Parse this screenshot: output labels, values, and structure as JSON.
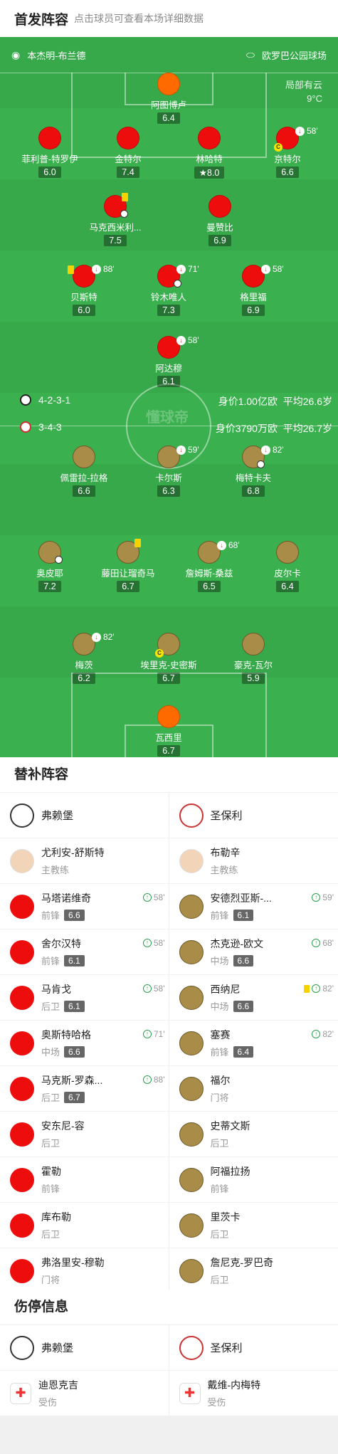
{
  "header": {
    "title": "首发阵容",
    "subtitle": "点击球员可查看本场详细数据"
  },
  "match": {
    "coach_home": "本杰明-布兰德",
    "stadium": "欧罗巴公园球场",
    "weather": "局部有云",
    "temp": "9°C"
  },
  "home_form": {
    "formation": "4-2-3-1",
    "value": "身价1.00亿欧",
    "age": "平均26.6岁"
  },
  "away_form": {
    "formation": "3-4-3",
    "value": "身价3790万欧",
    "age": "平均26.7岁"
  },
  "watermark": "懂球帝",
  "home_players": [
    {
      "name": "阿图博卢",
      "rating": "6.4"
    },
    {
      "name": "菲利普-特罗伊",
      "rating": "6.0"
    },
    {
      "name": "金特尔",
      "rating": "7.4"
    },
    {
      "name": "林哈特",
      "rating": "8.0"
    },
    {
      "name": "京特尔",
      "rating": "6.6",
      "sub": "58'"
    },
    {
      "name": "马克西米利...",
      "rating": "7.5"
    },
    {
      "name": "曼赞比",
      "rating": "6.9"
    },
    {
      "name": "贝斯特",
      "rating": "6.0",
      "sub": "88'"
    },
    {
      "name": "铃木唯人",
      "rating": "7.3",
      "sub": "71'"
    },
    {
      "name": "格里福",
      "rating": "6.9",
      "sub": "58'"
    },
    {
      "name": "阿达穆",
      "rating": "6.1",
      "sub": "58'"
    }
  ],
  "away_players": [
    {
      "name": "佩雷拉-拉格",
      "rating": "6.6"
    },
    {
      "name": "卡尔斯",
      "rating": "6.3",
      "sub": "59'"
    },
    {
      "name": "梅特卡夫",
      "rating": "6.8",
      "sub": "82'"
    },
    {
      "name": "奥皮耶",
      "rating": "7.2"
    },
    {
      "name": "藤田让瑠奇马",
      "rating": "6.7"
    },
    {
      "name": "詹姆斯-桑兹",
      "rating": "6.5",
      "sub": "68'"
    },
    {
      "name": "皮尔卡",
      "rating": "6.4"
    },
    {
      "name": "梅茨",
      "rating": "6.2",
      "sub": "82'"
    },
    {
      "name": "埃里克-史密斯",
      "rating": "6.7"
    },
    {
      "name": "豪克-瓦尔",
      "rating": "5.9"
    },
    {
      "name": "瓦西里",
      "rating": "6.7"
    }
  ],
  "subs": {
    "title": "替补阵容",
    "home_team": "弗赖堡",
    "away_team": "圣保利",
    "home_coach": {
      "name": "尤利安-舒斯特",
      "role": "主教练"
    },
    "away_coach": {
      "name": "布勒辛",
      "role": "主教练"
    },
    "home": [
      {
        "name": "马塔诺维奇",
        "pos": "前锋",
        "rating": "6.6",
        "ev": "58'"
      },
      {
        "name": "舍尔汉特",
        "pos": "前锋",
        "rating": "6.1",
        "ev": "58'"
      },
      {
        "name": "马肯戈",
        "pos": "后卫",
        "rating": "6.1",
        "ev": "58'"
      },
      {
        "name": "奥斯特哈格",
        "pos": "中场",
        "rating": "6.6",
        "ev": "71'"
      },
      {
        "name": "马克斯-罗森...",
        "pos": "后卫",
        "rating": "6.7",
        "ev": "88'"
      },
      {
        "name": "安东尼-容",
        "pos": "后卫"
      },
      {
        "name": "霍勒",
        "pos": "前锋"
      },
      {
        "name": "库布勒",
        "pos": "后卫"
      },
      {
        "name": "弗洛里安-穆勒",
        "pos": "门将"
      }
    ],
    "away": [
      {
        "name": "安德烈亚斯-...",
        "pos": "前锋",
        "rating": "6.1",
        "ev": "59'"
      },
      {
        "name": "杰克逊-欧文",
        "pos": "中场",
        "rating": "6.6",
        "ev": "68'"
      },
      {
        "name": "西纳尼",
        "pos": "中场",
        "rating": "6.6",
        "ev": "82'"
      },
      {
        "name": "塞赛",
        "pos": "前锋",
        "rating": "6.4",
        "ev": "82'"
      },
      {
        "name": "福尔",
        "pos": "门将"
      },
      {
        "name": "史蒂文斯",
        "pos": "后卫"
      },
      {
        "name": "阿福拉扬",
        "pos": "前锋"
      },
      {
        "name": "里茨卡",
        "pos": "后卫"
      },
      {
        "name": "詹尼克-罗巴奇",
        "pos": "后卫"
      }
    ]
  },
  "injury": {
    "title": "伤停信息",
    "home_team": "弗赖堡",
    "away_team": "圣保利",
    "home": {
      "name": "迪恩克吉",
      "status": "受伤"
    },
    "away": {
      "name": "戴维-内梅特",
      "status": "受伤"
    }
  }
}
